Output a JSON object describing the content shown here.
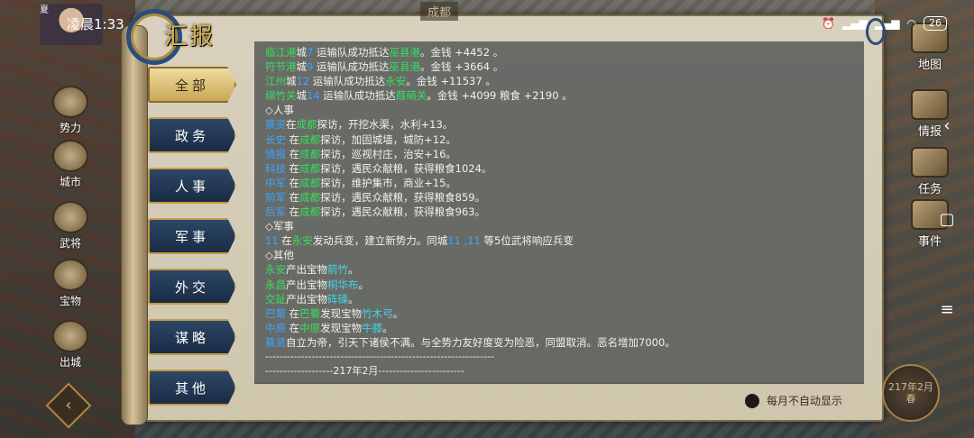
{
  "status_bar": {
    "time": "凌晨1:33",
    "season_tag": "夏",
    "battery": "26"
  },
  "top_label": "成都",
  "title": "汇报",
  "left_menu": [
    {
      "label": "势力"
    },
    {
      "label": "城市"
    },
    {
      "label": "武将"
    },
    {
      "label": "宝物"
    },
    {
      "label": "出城"
    }
  ],
  "right_menu": [
    {
      "label": "地图"
    },
    {
      "label": "情报"
    },
    {
      "label": "任务"
    },
    {
      "label": "事件"
    }
  ],
  "date_badge": "217年2月\n春",
  "tabs": [
    {
      "label": "全部",
      "active": true
    },
    {
      "label": "政务",
      "active": false
    },
    {
      "label": "人事",
      "active": false
    },
    {
      "label": "军事",
      "active": false
    },
    {
      "label": "外交",
      "active": false
    },
    {
      "label": "谋略",
      "active": false
    },
    {
      "label": "其他",
      "active": false
    }
  ],
  "report_lines": [
    [
      {
        "t": "临江港",
        "c": "g"
      },
      {
        "t": "城",
        "c": "w"
      },
      {
        "t": "7",
        "c": "b"
      },
      {
        "t": " 运输队成功抵达",
        "c": "w"
      },
      {
        "t": "巫县港",
        "c": "g"
      },
      {
        "t": "。金钱 +4452 。",
        "c": "w"
      }
    ],
    [
      {
        "t": "符节港",
        "c": "g"
      },
      {
        "t": "城",
        "c": "w"
      },
      {
        "t": "9",
        "c": "b"
      },
      {
        "t": " 运输队成功抵达",
        "c": "w"
      },
      {
        "t": "巫县港",
        "c": "g"
      },
      {
        "t": "。金钱 +3664 。",
        "c": "w"
      }
    ],
    [
      {
        "t": "江州",
        "c": "g"
      },
      {
        "t": "城",
        "c": "w"
      },
      {
        "t": "12",
        "c": "b"
      },
      {
        "t": " 运输队成功抵达",
        "c": "w"
      },
      {
        "t": "永安",
        "c": "g"
      },
      {
        "t": "。金钱 +11537 。",
        "c": "w"
      }
    ],
    [
      {
        "t": "绵竹关",
        "c": "g"
      },
      {
        "t": "城",
        "c": "w"
      },
      {
        "t": "14",
        "c": "b"
      },
      {
        "t": " 运输队成功抵达",
        "c": "w"
      },
      {
        "t": "葭萌关",
        "c": "g"
      },
      {
        "t": "。金钱 +4099 粮食 +2190 。",
        "c": "w"
      }
    ],
    [
      {
        "t": "◇人事",
        "c": "w"
      }
    ],
    [
      {
        "t": "蔡资",
        "c": "b"
      },
      {
        "t": "在",
        "c": "w"
      },
      {
        "t": "成都",
        "c": "g"
      },
      {
        "t": "探访，开挖水渠，水利+13。",
        "c": "w"
      }
    ],
    [
      {
        "t": "长史",
        "c": "b"
      },
      {
        "t": " 在",
        "c": "w"
      },
      {
        "t": "成都",
        "c": "g"
      },
      {
        "t": "探访，加固城墙，城防+12。",
        "c": "w"
      }
    ],
    [
      {
        "t": "情报",
        "c": "b"
      },
      {
        "t": " 在",
        "c": "w"
      },
      {
        "t": "成都",
        "c": "g"
      },
      {
        "t": "探访，巡视村庄，治安+16。",
        "c": "w"
      }
    ],
    [
      {
        "t": "科技",
        "c": "b"
      },
      {
        "t": " 在",
        "c": "w"
      },
      {
        "t": "成都",
        "c": "g"
      },
      {
        "t": "探访，遇民众献粮，获得粮食1024。",
        "c": "w"
      }
    ],
    [
      {
        "t": "中军",
        "c": "b"
      },
      {
        "t": " 在",
        "c": "w"
      },
      {
        "t": "成都",
        "c": "g"
      },
      {
        "t": "探访，维护集市，商业+15。",
        "c": "w"
      }
    ],
    [
      {
        "t": "前军",
        "c": "b"
      },
      {
        "t": " 在",
        "c": "w"
      },
      {
        "t": "成都",
        "c": "g"
      },
      {
        "t": "探访，遇民众献粮，获得粮食859。",
        "c": "w"
      }
    ],
    [
      {
        "t": "后军",
        "c": "b"
      },
      {
        "t": " 在",
        "c": "w"
      },
      {
        "t": "成都",
        "c": "g"
      },
      {
        "t": "探访，遇民众献粮，获得粮食963。",
        "c": "w"
      }
    ],
    [
      {
        "t": "◇军事",
        "c": "w"
      }
    ],
    [
      {
        "t": " 11",
        "c": "b"
      },
      {
        "t": " 在",
        "c": "w"
      },
      {
        "t": "永安",
        "c": "g"
      },
      {
        "t": "发动兵变，建立新势力。同城",
        "c": "w"
      },
      {
        "t": "11 ,11",
        "c": "b"
      },
      {
        "t": " 等5位武将响应兵变",
        "c": "w"
      }
    ],
    [
      {
        "t": "◇其他",
        "c": "w"
      }
    ],
    [
      {
        "t": "永安",
        "c": "g"
      },
      {
        "t": "产出宝物",
        "c": "w"
      },
      {
        "t": "箭竹",
        "c": "cyan"
      },
      {
        "t": "。",
        "c": "w"
      }
    ],
    [
      {
        "t": "永昌",
        "c": "g"
      },
      {
        "t": "产出宝物",
        "c": "w"
      },
      {
        "t": "桐华布",
        "c": "cyan"
      },
      {
        "t": "。",
        "c": "w"
      }
    ],
    [
      {
        "t": "交趾",
        "c": "g"
      },
      {
        "t": "产出宝物",
        "c": "w"
      },
      {
        "t": "砗磲",
        "c": "cyan"
      },
      {
        "t": "。",
        "c": "w"
      }
    ],
    [
      {
        "t": "巴蜀",
        "c": "b"
      },
      {
        "t": " 在",
        "c": "w"
      },
      {
        "t": "巴蜀",
        "c": "g"
      },
      {
        "t": "发现宝物",
        "c": "w"
      },
      {
        "t": "竹木弓",
        "c": "cyan"
      },
      {
        "t": "。",
        "c": "w"
      }
    ],
    [
      {
        "t": "中原",
        "c": "b"
      },
      {
        "t": " 在",
        "c": "w"
      },
      {
        "t": "中原",
        "c": "g"
      },
      {
        "t": "发现宝物",
        "c": "w"
      },
      {
        "t": "牛膝",
        "c": "cyan"
      },
      {
        "t": "。",
        "c": "w"
      }
    ],
    [
      {
        "t": " 蔡贤",
        "c": "b"
      },
      {
        "t": "自立为帝，引天下诸侯不满。与全势力友好度变为险恶，同盟取消。恶名增加7000。",
        "c": "w"
      }
    ]
  ],
  "separator_line": "----------------------------------------------------------------",
  "month_separator": "-------------------217年2月------------------------",
  "auto_show_label": "每月不自动显示"
}
